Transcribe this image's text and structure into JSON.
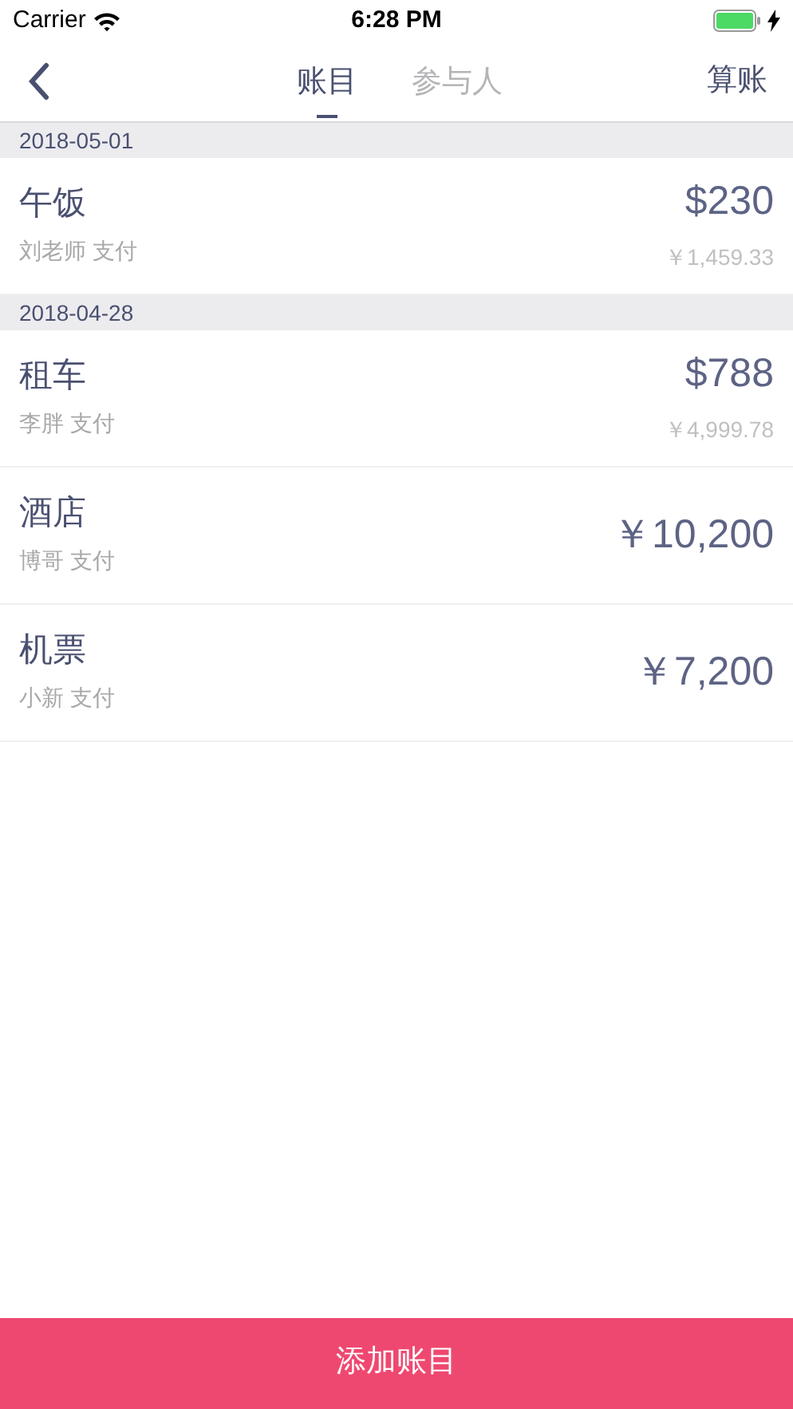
{
  "status_bar": {
    "carrier": "Carrier",
    "time": "6:28 PM"
  },
  "nav": {
    "tabs": [
      {
        "label": "账目",
        "selected": true
      },
      {
        "label": "参与人",
        "selected": false
      }
    ],
    "action": "算账"
  },
  "sections": [
    {
      "date": "2018-05-01",
      "items": [
        {
          "title": "午饭",
          "payer": "刘老师 支付",
          "amount": "$230",
          "converted": "￥1,459.33"
        }
      ]
    },
    {
      "date": "2018-04-28",
      "items": [
        {
          "title": "租车",
          "payer": "李胖 支付",
          "amount": "$788",
          "converted": "￥4,999.78"
        },
        {
          "title": "酒店",
          "payer": "博哥 支付",
          "amount": "￥10,200"
        },
        {
          "title": "机票",
          "payer": "小新 支付",
          "amount": "￥7,200"
        }
      ]
    }
  ],
  "add_button": "添加账目"
}
